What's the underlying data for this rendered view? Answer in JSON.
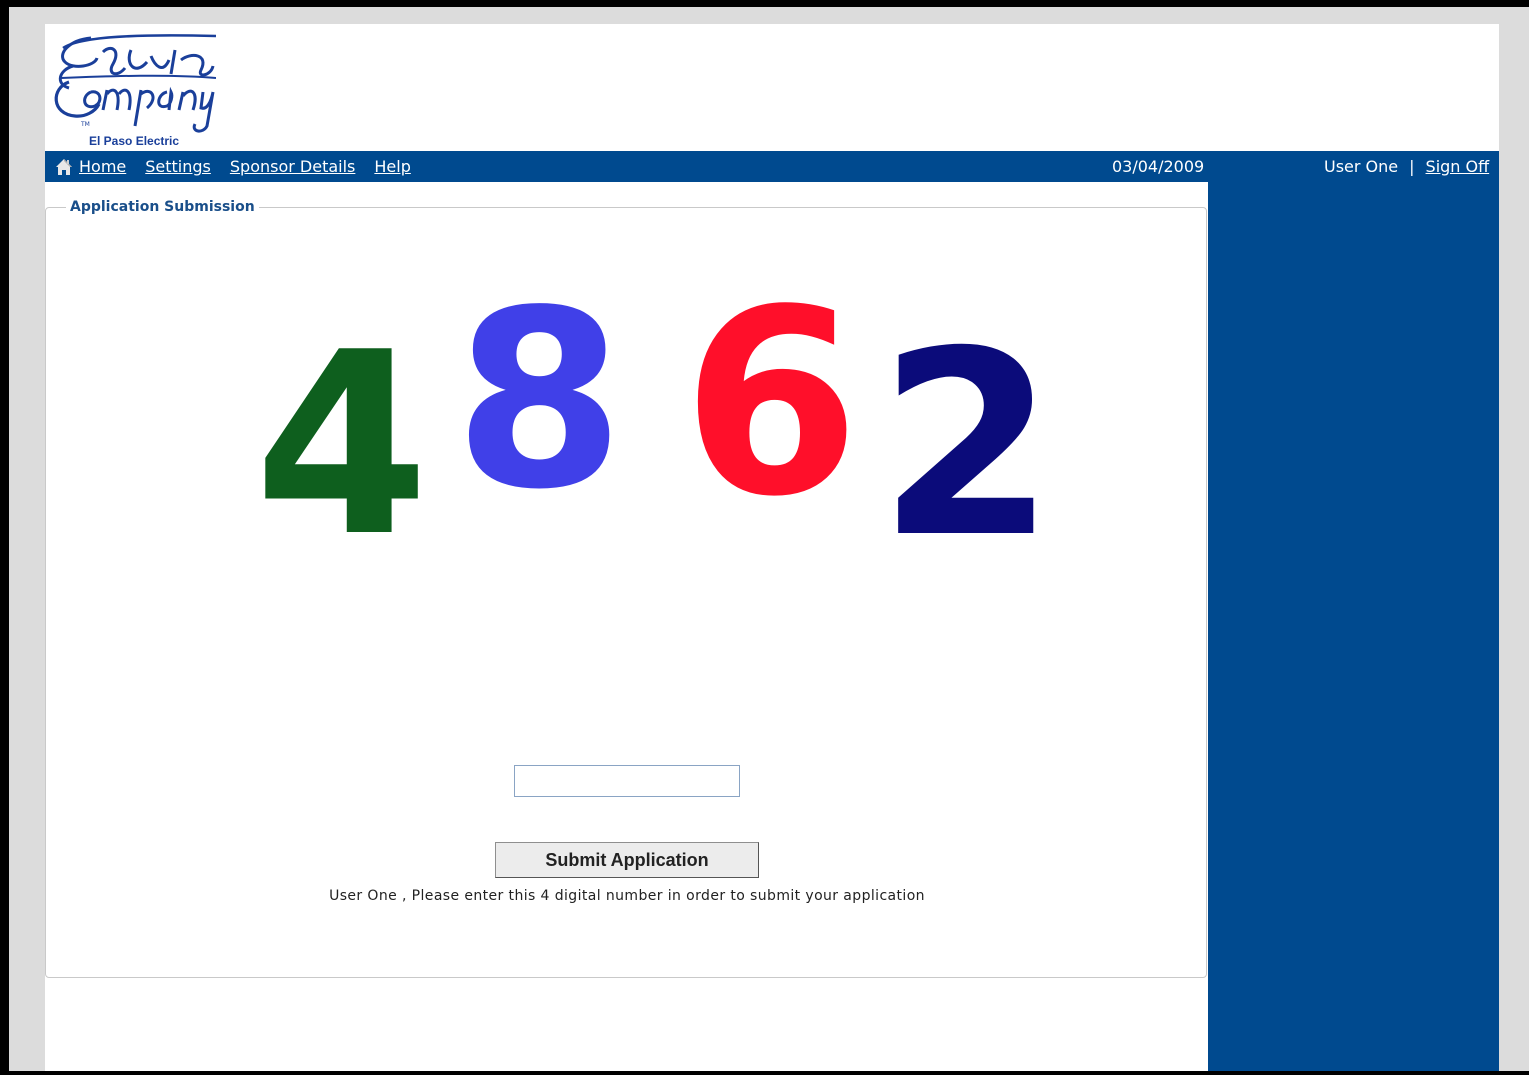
{
  "logo": {
    "alt": "The Electric Company",
    "caption": "El Paso Electric"
  },
  "nav": {
    "links": [
      "Home",
      "Settings",
      "Sponsor Details",
      "Help"
    ],
    "date": "03/04/2009",
    "user": "User One",
    "separator": "|",
    "sign_off": "Sign Off"
  },
  "panel": {
    "legend": "Application Submission",
    "captcha_digits": [
      {
        "digit": "4",
        "color": "#0e5f1e"
      },
      {
        "digit": "8",
        "color": "#4040e8"
      },
      {
        "digit": "6",
        "color": "#ff0f2a"
      },
      {
        "digit": "2",
        "color": "#0b0b7a"
      }
    ],
    "instruction": "User One , Please enter this 4 digital number in order to submit your application",
    "input_value": "",
    "submit_label": "Submit Application"
  },
  "colors": {
    "nav_bar": "#004a8f",
    "sidebar": "#004a8f",
    "legend_text": "#1a4f8a"
  }
}
